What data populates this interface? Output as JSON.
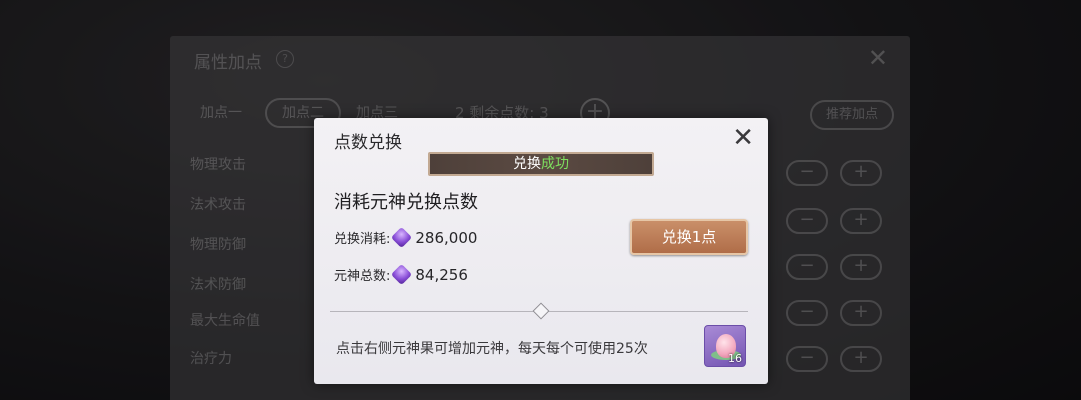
{
  "attribute_panel": {
    "title": "属性加点",
    "help_icon": "?",
    "close_icon": "✕",
    "tabs": [
      {
        "label": "加点一"
      },
      {
        "label": "加点二",
        "active": true
      },
      {
        "label": "加点三"
      }
    ],
    "remaining_label": "2  剩余点数: 3",
    "recommend_label": "推荐加点",
    "rows": [
      "物理攻击",
      "法术攻击",
      "物理防御",
      "法术防御",
      "最大生命值",
      "治疗力"
    ],
    "minus": "−",
    "plus": "+"
  },
  "dialog": {
    "title": "点数兑换",
    "close_icon": "✕",
    "toast_part1": "兑换",
    "toast_part2": "成功",
    "heading": "消耗元神兑换点数",
    "cost_label": "兑换消耗:",
    "cost_value": "286,000",
    "total_label": "元神总数:",
    "total_value": "84,256",
    "exchange_button": "兑换1点",
    "hint": "点击右侧元神果可增加元神，每天每个可使用25次",
    "item_count": "16",
    "slider_level": 0.5,
    "colors": {
      "success": "#7ee05f",
      "button": "#b06d48",
      "gem": "#8a4fd8"
    }
  }
}
